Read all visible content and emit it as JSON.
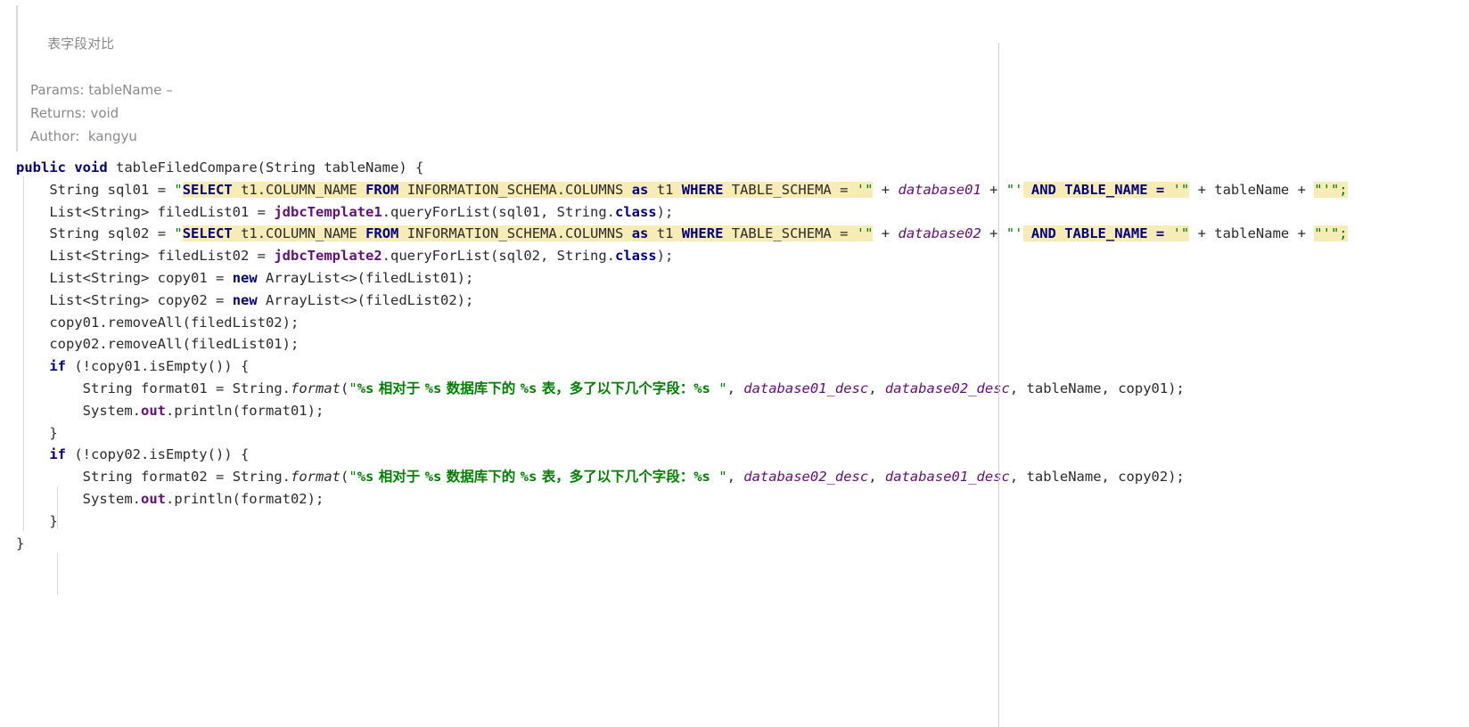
{
  "doc": {
    "summary": "表字段对比",
    "params_label": "Params:",
    "params_value": "tableName –",
    "returns_label": "Returns:",
    "returns_value": "void",
    "author_label": "Author:",
    "author_value": "kangyu"
  },
  "code": {
    "signature": {
      "kw_public": "public",
      "kw_void": "void",
      "method_name": "tableFiledCompare",
      "open_paren": "(",
      "param_type": "String",
      "param_name": "tableName",
      "close_paren": ")",
      "brace": "{"
    },
    "line_sql01": {
      "type": "String",
      "var": "sql01",
      "eq": "=",
      "q1": "\"",
      "sql_select": "SELECT",
      "sql_cols": "t1.COLUMN_NAME",
      "sql_from": "FROM",
      "sql_table": "INFORMATION_SCHEMA.COLUMNS",
      "sql_as": "as",
      "sql_alias": "t1",
      "sql_where": "WHERE",
      "sql_field1": "TABLE_SCHEMA",
      "sql_eq1": "=",
      "sql_tick_q": "'\"",
      "plus1": "+",
      "db_var": "database01",
      "plus2": "+",
      "q2": "\"'",
      "sql_and": "AND",
      "sql_field2": "TABLE_NAME",
      "sql_eq2": "=",
      "sql_tick_q2": "'\"",
      "plus3": "+",
      "tablename": "tableName",
      "plus4": "+",
      "q3": "\"'\";"
    },
    "line_list01": {
      "type": "List<String>",
      "var": "filedList01",
      "eq": "=",
      "template": "jdbcTemplate1",
      "dot_method": ".queryForList(",
      "arg1": "sql01, ",
      "arg2": "String.",
      "kw_class": "class",
      "tail": ");"
    },
    "line_sql02": {
      "type": "String",
      "var": "sql02",
      "eq": "=",
      "q1": "\"",
      "sql_select": "SELECT",
      "sql_cols": "t1.COLUMN_NAME",
      "sql_from": "FROM",
      "sql_table": "INFORMATION_SCHEMA.COLUMNS",
      "sql_as": "as",
      "sql_alias": "t1",
      "sql_where": "WHERE",
      "sql_field1": "TABLE_SCHEMA",
      "sql_eq1": "=",
      "sql_tick_q": "'\"",
      "plus1": "+",
      "db_var": "database02",
      "plus2": "+",
      "q2": "\"'",
      "sql_and": "AND",
      "sql_field2": "TABLE_NAME",
      "sql_eq2": "=",
      "sql_tick_q2": "'\"",
      "plus3": "+",
      "tablename": "tableName",
      "plus4": "+",
      "q3": "\"'\";"
    },
    "line_list02": {
      "type": "List<String>",
      "var": "filedList02",
      "eq": "=",
      "template": "jdbcTemplate2",
      "dot_method": ".queryForList(",
      "arg1": "sql02, ",
      "arg2": "String.",
      "kw_class": "class",
      "tail": ");"
    },
    "line_copy01": {
      "type": "List<String>",
      "var": "copy01",
      "eq": "=",
      "kw_new": "new",
      "ctor": "ArrayList<>(filedList01);"
    },
    "line_copy02": {
      "type": "List<String>",
      "var": "copy02",
      "eq": "=",
      "kw_new": "new",
      "ctor": "ArrayList<>(filedList02);"
    },
    "line_removeall01": "copy01.removeAll(filedList02);",
    "line_removeall02": "copy02.removeAll(filedList01);",
    "if01": {
      "kw_if": "if",
      "cond": " (!copy01.isEmpty()) {"
    },
    "format01": {
      "type": "String",
      "var": "format01",
      "eq": "=",
      "cls": "String.",
      "method": "format",
      "open": "(",
      "q_open": "\"",
      "fmt_a": "%s",
      "cjk_a": " 相对于 ",
      "fmt_b": "%s",
      "cjk_b": " 数据库下的 ",
      "fmt_c": "%s",
      "cjk_c": " 表，多了以下几个字段：",
      "fmt_d": "%s",
      "q_close": " \"",
      "comma": ", ",
      "arg1": "database01_desc",
      "sep1": ", ",
      "arg2": "database02_desc",
      "sep2": ", ",
      "arg3": "tableName",
      "sep3": ", ",
      "arg4": "copy01",
      "tail": ");"
    },
    "println01": {
      "sys": "System.",
      "out": "out",
      "rest": ".println(format01);"
    },
    "close_if01": "}",
    "if02": {
      "kw_if": "if",
      "cond": " (!copy02.isEmpty()) {"
    },
    "format02": {
      "type": "String",
      "var": "format02",
      "eq": "=",
      "cls": "String.",
      "method": "format",
      "open": "(",
      "q_open": "\"",
      "fmt_a": "%s",
      "cjk_a": " 相对于 ",
      "fmt_b": "%s",
      "cjk_b": " 数据库下的 ",
      "fmt_c": "%s",
      "cjk_c": " 表，多了以下几个字段：",
      "fmt_d": "%s",
      "q_close": " \"",
      "comma": ", ",
      "arg1": "database02_desc",
      "sep1": ", ",
      "arg2": "database01_desc",
      "sep2": ", ",
      "arg3": "tableName",
      "sep3": ", ",
      "arg4": "copy02",
      "tail": ");"
    },
    "println02": {
      "sys": "System.",
      "out": "out",
      "rest": ".println(format02);"
    },
    "close_if02": "}",
    "close_method": "}"
  },
  "colors": {
    "keyword": "#000080",
    "string": "#008000",
    "field": "#660e7a",
    "sql_highlight": "#f7ecb5",
    "doc_text": "#8a8a8a",
    "plain_text": "#2b2b2b",
    "guide_line": "#d9d9d9"
  }
}
